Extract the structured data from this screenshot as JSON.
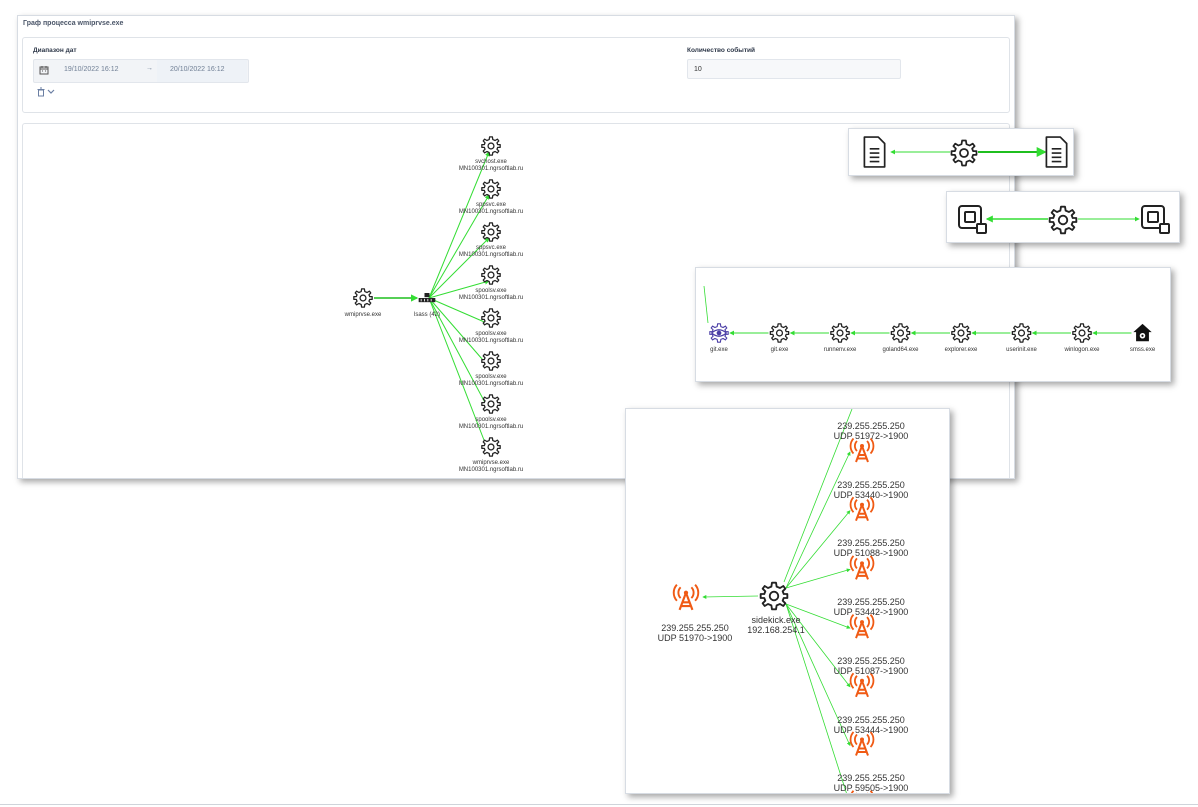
{
  "main_window": {
    "title": "Граф процесса wmiprvse.exe",
    "filters": {
      "date_range_label": "Диапазон дат",
      "start_date": "19/10/2022 16:12",
      "range_arrow": "→",
      "end_date": "20/10/2022 16:12",
      "event_count_label": "Количество событий",
      "event_count_value": "10"
    },
    "graph": {
      "root": {
        "label": "wmiprvse.exe",
        "icon": "gear-icon"
      },
      "hub": {
        "label": "lsass (42)",
        "icon": "network-switch-icon"
      },
      "children": [
        {
          "name": "svchost.exe",
          "host": "MN100301.ngrsoftlab.ru"
        },
        {
          "name": "sppsvc.exe",
          "host": "MN100301.ngrsoftlab.ru"
        },
        {
          "name": "sppsvc.exe",
          "host": "MN100301.ngrsoftlab.ru"
        },
        {
          "name": "spoolsv.exe",
          "host": "MN100301.ngrsoftlab.ru"
        },
        {
          "name": "spoolsv.exe",
          "host": "MN100301.ngrsoftlab.ru"
        },
        {
          "name": "spoolsv.exe",
          "host": "MN100301.ngrsoftlab.ru"
        },
        {
          "name": "spoolsv.exe",
          "host": "MN100301.ngrsoftlab.ru"
        },
        {
          "name": "wmiprvse.exe",
          "host": "MN100301.ngrsoftlab.ru"
        }
      ]
    }
  },
  "file_graph": {
    "nodes": [
      "file-icon",
      "gear-icon",
      "file-icon"
    ]
  },
  "registry_graph": {
    "nodes": [
      "registry-icon",
      "gear-icon",
      "registry-icon"
    ]
  },
  "chain_graph": {
    "nodes": [
      {
        "label": "git.exe",
        "icon": "eye-icon"
      },
      {
        "label": "git.exe",
        "icon": "gear-icon"
      },
      {
        "label": "runnenv.exe",
        "icon": "gear-icon"
      },
      {
        "label": "goland64.exe",
        "icon": "gear-icon"
      },
      {
        "label": "explorer.exe",
        "icon": "gear-icon"
      },
      {
        "label": "userinit.exe",
        "icon": "gear-icon"
      },
      {
        "label": "winlogon.exe",
        "icon": "gear-icon"
      },
      {
        "label": "smss.exe",
        "icon": "house-gear-icon"
      }
    ]
  },
  "network_graph": {
    "center": {
      "name": "sidekick.exe",
      "ip": "192.168.254.1"
    },
    "left": {
      "ip": "239.255.255.250",
      "conn": "UDP 51970->1900"
    },
    "right": [
      {
        "ip": "239.255.255.250",
        "conn": "UDP 51972->1900"
      },
      {
        "ip": "239.255.255.250",
        "conn": "UDP 53440->1900"
      },
      {
        "ip": "239.255.255.250",
        "conn": "UDP 51088->1900"
      },
      {
        "ip": "239.255.255.250",
        "conn": "UDP 53442->1900"
      },
      {
        "ip": "239.255.255.250",
        "conn": "UDP 51087->1900"
      },
      {
        "ip": "239.255.255.250",
        "conn": "UDP 53444->1900"
      },
      {
        "ip": "239.255.255.250",
        "conn": "UDP 59505->1900"
      }
    ]
  },
  "colors": {
    "edge": "#33dd33",
    "antenna": "#f05a14",
    "eye": "#4b3ea6",
    "icon": "#222222"
  }
}
